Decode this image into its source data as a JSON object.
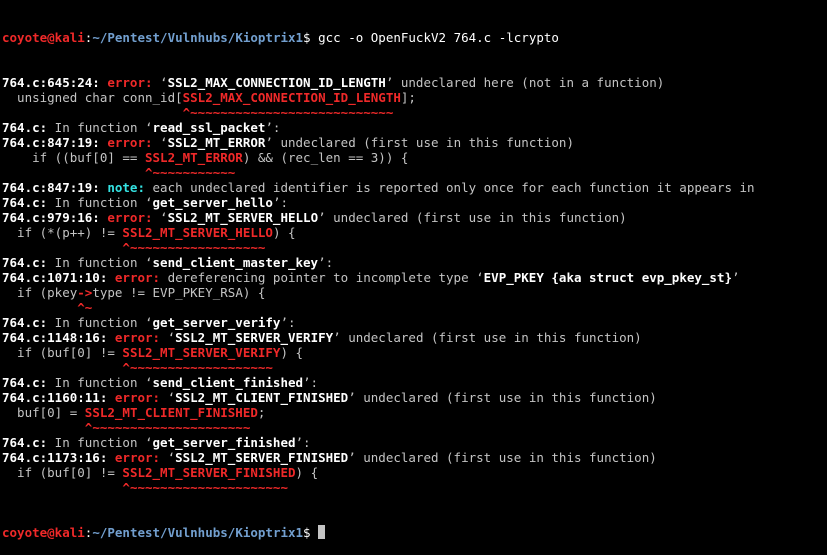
{
  "prompt_top": {
    "user": "coyote@kali",
    "sep": ":",
    "path": "~/Pentest/Vulnhubs/Kioptrix1",
    "symbol": "$",
    "command": " gcc -o OpenFuckV2 764.c -lcrypto"
  },
  "output": [
    [
      {
        "t": "764.c:645:24: ",
        "c": "b"
      },
      {
        "t": "error: ",
        "c": "err"
      },
      {
        "t": "‘"
      },
      {
        "t": "SSL2_MAX_CONNECTION_ID_LENGTH",
        "c": "b"
      },
      {
        "t": "’ undeclared here (not in a function)"
      }
    ],
    [
      {
        "t": "  unsigned char conn_id["
      },
      {
        "t": "SSL2_MAX_CONNECTION_ID_LENGTH",
        "c": "redb"
      },
      {
        "t": "];"
      }
    ],
    [
      {
        "t": "                        "
      },
      {
        "t": "^~~~~~~~~~~~~~~~~~~~~~~~~~~~",
        "c": "redb"
      }
    ],
    [
      {
        "t": "764.c:",
        "c": "b"
      },
      {
        "t": " In function ‘"
      },
      {
        "t": "read_ssl_packet",
        "c": "b"
      },
      {
        "t": "’:"
      }
    ],
    [
      {
        "t": "764.c:847:19: ",
        "c": "b"
      },
      {
        "t": "error: ",
        "c": "err"
      },
      {
        "t": "‘"
      },
      {
        "t": "SSL2_MT_ERROR",
        "c": "b"
      },
      {
        "t": "’ undeclared (first use in this function)"
      }
    ],
    [
      {
        "t": "    if ((buf[0] == "
      },
      {
        "t": "SSL2_MT_ERROR",
        "c": "redb"
      },
      {
        "t": ") && (rec_len == 3)) {"
      }
    ],
    [
      {
        "t": "                   "
      },
      {
        "t": "^~~~~~~~~~~~",
        "c": "redb"
      }
    ],
    [
      {
        "t": "764.c:847:19: ",
        "c": "b"
      },
      {
        "t": "note: ",
        "c": "note"
      },
      {
        "t": "each undeclared identifier is reported only once for each function it appears in"
      }
    ],
    [
      {
        "t": "764.c:",
        "c": "b"
      },
      {
        "t": " In function ‘"
      },
      {
        "t": "get_server_hello",
        "c": "b"
      },
      {
        "t": "’:"
      }
    ],
    [
      {
        "t": "764.c:979:16: ",
        "c": "b"
      },
      {
        "t": "error: ",
        "c": "err"
      },
      {
        "t": "‘"
      },
      {
        "t": "SSL2_MT_SERVER_HELLO",
        "c": "b"
      },
      {
        "t": "’ undeclared (first use in this function)"
      }
    ],
    [
      {
        "t": "  if (*(p++) != "
      },
      {
        "t": "SSL2_MT_SERVER_HELLO",
        "c": "redb"
      },
      {
        "t": ") {"
      }
    ],
    [
      {
        "t": "                "
      },
      {
        "t": "^~~~~~~~~~~~~~~~~~~",
        "c": "redb"
      }
    ],
    [
      {
        "t": "764.c:",
        "c": "b"
      },
      {
        "t": " In function ‘"
      },
      {
        "t": "send_client_master_key",
        "c": "b"
      },
      {
        "t": "’:"
      }
    ],
    [
      {
        "t": "764.c:1071:10: ",
        "c": "b"
      },
      {
        "t": "error: ",
        "c": "err"
      },
      {
        "t": "dereferencing pointer to incomplete type ‘"
      },
      {
        "t": "EVP_PKEY {aka struct evp_pkey_st}",
        "c": "b"
      },
      {
        "t": "’"
      }
    ],
    [
      {
        "t": "  if (pkey"
      },
      {
        "t": "->",
        "c": "redb"
      },
      {
        "t": "type != EVP_PKEY_RSA) {"
      }
    ],
    [
      {
        "t": "          "
      },
      {
        "t": "^~",
        "c": "redb"
      }
    ],
    [
      {
        "t": "764.c:",
        "c": "b"
      },
      {
        "t": " In function ‘"
      },
      {
        "t": "get_server_verify",
        "c": "b"
      },
      {
        "t": "’:"
      }
    ],
    [
      {
        "t": "764.c:1148:16: ",
        "c": "b"
      },
      {
        "t": "error: ",
        "c": "err"
      },
      {
        "t": "‘"
      },
      {
        "t": "SSL2_MT_SERVER_VERIFY",
        "c": "b"
      },
      {
        "t": "’ undeclared (first use in this function)"
      }
    ],
    [
      {
        "t": "  if (buf[0] != "
      },
      {
        "t": "SSL2_MT_SERVER_VERIFY",
        "c": "redb"
      },
      {
        "t": ") {"
      }
    ],
    [
      {
        "t": "                "
      },
      {
        "t": "^~~~~~~~~~~~~~~~~~~~",
        "c": "redb"
      }
    ],
    [
      {
        "t": "764.c:",
        "c": "b"
      },
      {
        "t": " In function ‘"
      },
      {
        "t": "send_client_finished",
        "c": "b"
      },
      {
        "t": "’:"
      }
    ],
    [
      {
        "t": "764.c:1160:11: ",
        "c": "b"
      },
      {
        "t": "error: ",
        "c": "err"
      },
      {
        "t": "‘"
      },
      {
        "t": "SSL2_MT_CLIENT_FINISHED",
        "c": "b"
      },
      {
        "t": "’ undeclared (first use in this function)"
      }
    ],
    [
      {
        "t": "  buf[0] = "
      },
      {
        "t": "SSL2_MT_CLIENT_FINISHED",
        "c": "redb"
      },
      {
        "t": ";"
      }
    ],
    [
      {
        "t": "           "
      },
      {
        "t": "^~~~~~~~~~~~~~~~~~~~~~",
        "c": "redb"
      }
    ],
    [
      {
        "t": "764.c:",
        "c": "b"
      },
      {
        "t": " In function ‘"
      },
      {
        "t": "get_server_finished",
        "c": "b"
      },
      {
        "t": "’:"
      }
    ],
    [
      {
        "t": "764.c:1173:16: ",
        "c": "b"
      },
      {
        "t": "error: ",
        "c": "err"
      },
      {
        "t": "‘"
      },
      {
        "t": "SSL2_MT_SERVER_FINISHED",
        "c": "b"
      },
      {
        "t": "’ undeclared (first use in this function)"
      }
    ],
    [
      {
        "t": "  if (buf[0] != "
      },
      {
        "t": "SSL2_MT_SERVER_FINISHED",
        "c": "redb"
      },
      {
        "t": ") {"
      }
    ],
    [
      {
        "t": "                "
      },
      {
        "t": "^~~~~~~~~~~~~~~~~~~~~~",
        "c": "redb"
      }
    ]
  ],
  "prompt_bottom": {
    "user": "coyote@kali",
    "sep": ":",
    "path": "~/Pentest/Vulnhubs/Kioptrix1",
    "symbol": "$",
    "command": " "
  },
  "colors": {
    "background": "#000000",
    "text": "#c4c4c4",
    "error": "#ef2929",
    "note": "#34e2e2",
    "path": "#729fcf"
  }
}
